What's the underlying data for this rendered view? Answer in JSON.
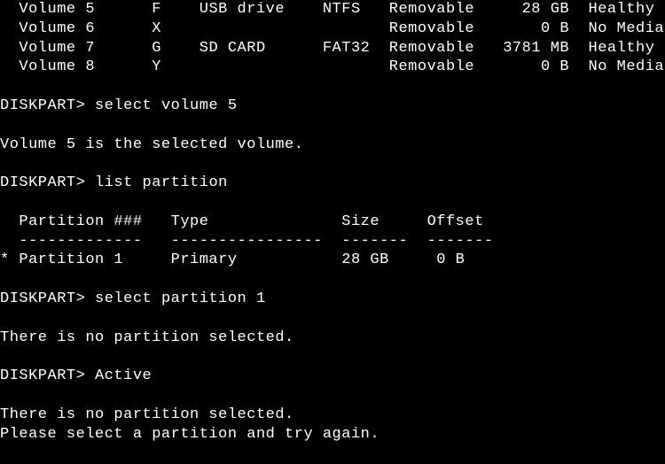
{
  "prompt": "DISKPART>",
  "volume_list": {
    "rows": [
      {
        "name": "Volume 5",
        "ltr": "F",
        "label": "USB drive",
        "fs": "NTFS",
        "type": "Removable",
        "size": "28 GB",
        "status": "Healthy"
      },
      {
        "name": "Volume 6",
        "ltr": "X",
        "label": "",
        "fs": "",
        "type": "Removable",
        "size": "0 B",
        "status": "No Media"
      },
      {
        "name": "Volume 7",
        "ltr": "G",
        "label": "SD CARD",
        "fs": "FAT32",
        "type": "Removable",
        "size": "3781 MB",
        "status": "Healthy"
      },
      {
        "name": "Volume 8",
        "ltr": "Y",
        "label": "",
        "fs": "",
        "type": "Removable",
        "size": "0 B",
        "status": "No Media"
      }
    ]
  },
  "cmd1": "select volume 5",
  "resp1": "Volume 5 is the selected volume.",
  "cmd2": "list partition",
  "partition_table": {
    "headers": {
      "c1": "Partition ###",
      "c2": "Type",
      "c3": "Size",
      "c4": "Offset"
    },
    "rules": {
      "c1": "-------------",
      "c2": "----------------",
      "c3": "-------",
      "c4": "-------"
    },
    "rows": [
      {
        "marker": "*",
        "c1": "Partition 1",
        "c2": "Primary",
        "c3": "28 GB",
        "c4": "0 B"
      }
    ]
  },
  "cmd3": "select partition 1",
  "resp3": "There is no partition selected.",
  "cmd4": "Active",
  "resp4a": "There is no partition selected.",
  "resp4b": "Please select a partition and try again."
}
